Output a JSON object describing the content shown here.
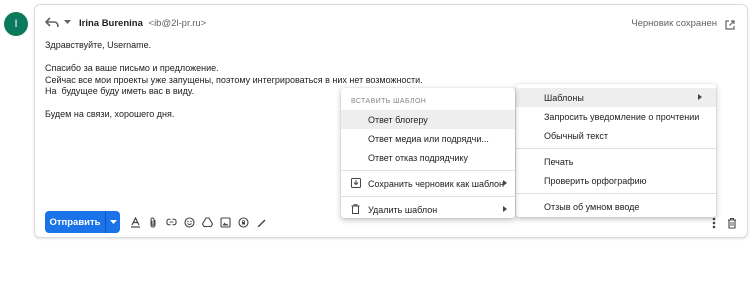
{
  "avatar": {
    "initial": "I",
    "color": "#0b7a5c"
  },
  "header": {
    "sender_name": "Irina Burenina",
    "sender_email": "<ib@2l-pr.ru>",
    "draft_status": "Черновик сохранен"
  },
  "body": {
    "lines": [
      "Здравствуйте, Username.",
      "Спасибо за ваше письмо и предложение.",
      "Сейчас все мои проекты уже запущены, поэтому интегрироваться в них нет возможности.",
      "На  будущее буду иметь вас в виду.",
      "Будем на связи, хорошего дня."
    ]
  },
  "toolbar": {
    "send_label": "Отправить",
    "accent_color": "#1a73e8",
    "icons": [
      "formatting-icon",
      "attach-icon",
      "link-icon",
      "emoji-icon",
      "drive-icon",
      "photo-icon",
      "confidential-icon",
      "signature-icon"
    ]
  },
  "more_menu": {
    "items": [
      {
        "label": "Шаблоны",
        "highlighted": true,
        "has_submenu": true
      },
      {
        "label": "Запросить уведомление о прочтении"
      },
      {
        "label": "Обычный текст"
      },
      {
        "label": "Печать"
      },
      {
        "label": "Проверить орфографию"
      },
      {
        "label": "Отзыв об умном вводе"
      }
    ]
  },
  "templates_menu": {
    "header": "ВСТАВИТЬ ШАБЛОН",
    "templates": [
      {
        "label": "Ответ блогеру",
        "highlighted": true
      },
      {
        "label": "Ответ медиа или подрядчи..."
      },
      {
        "label": "Ответ отказ подрядчику"
      }
    ],
    "save_label": "Сохранить черновик как шаблон",
    "delete_label": "Удалить шаблон"
  }
}
